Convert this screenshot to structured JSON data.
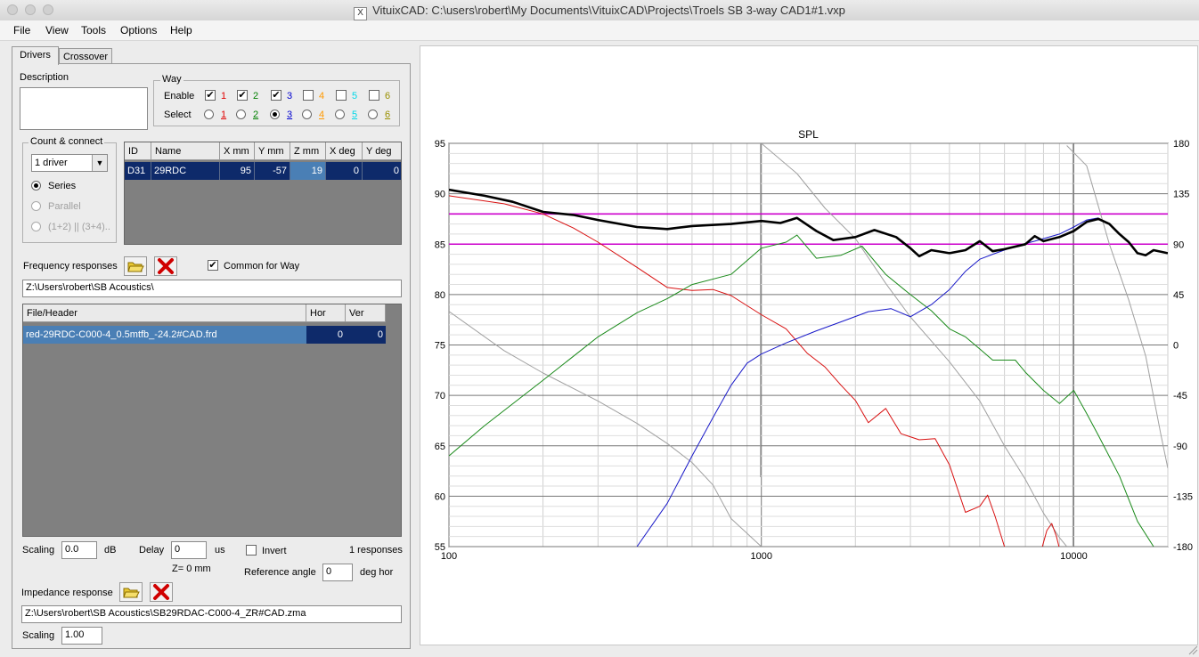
{
  "window": {
    "title": "VituixCAD: C:\\users\\robert\\My Documents\\VituixCAD\\Projects\\Troels SB 3-way CAD1#1.vxp",
    "app_icon": "app-icon"
  },
  "menu": [
    "File",
    "View",
    "Tools",
    "Options",
    "Help"
  ],
  "tabs": [
    "Drivers",
    "Crossover"
  ],
  "description": {
    "label": "Description",
    "value": ""
  },
  "way": {
    "title": "Way",
    "enable_label": "Enable",
    "select_label": "Select",
    "items": [
      {
        "n": "1",
        "color": "#e00000",
        "enabled": true,
        "selected": false
      },
      {
        "n": "2",
        "color": "#008000",
        "enabled": true,
        "selected": false
      },
      {
        "n": "3",
        "color": "#0000d0",
        "enabled": true,
        "selected": true
      },
      {
        "n": "4",
        "color": "#ff9900",
        "enabled": false,
        "selected": false
      },
      {
        "n": "5",
        "color": "#00d8e8",
        "enabled": false,
        "selected": false
      },
      {
        "n": "6",
        "color": "#9a9000",
        "enabled": false,
        "selected": false
      }
    ]
  },
  "count_connect": {
    "title": "Count & connect",
    "count": "1 driver",
    "options": [
      {
        "label": "Series",
        "selected": true,
        "disabled": false
      },
      {
        "label": "Parallel",
        "selected": false,
        "disabled": true
      },
      {
        "label": "(1+2) || (3+4)..",
        "selected": false,
        "disabled": true
      }
    ]
  },
  "driver_table": {
    "headers": [
      "ID",
      "Name",
      "X mm",
      "Y mm",
      "Z mm",
      "X deg",
      "Y deg"
    ],
    "rows": [
      [
        "D31",
        "29RDC",
        "95",
        "-57",
        "19",
        "0",
        "0"
      ]
    ]
  },
  "freq": {
    "label": "Frequency responses",
    "common_label": "Common for Way",
    "common_checked": true,
    "path": "Z:\\Users\\robert\\SB Acoustics\\"
  },
  "file_table": {
    "headers": [
      "File/Header",
      "Hor",
      "Ver"
    ],
    "rows": [
      [
        "red-29RDC-C000-4_0.5mtfb_-24.2#CAD.frd",
        "0",
        "0"
      ]
    ]
  },
  "params": {
    "scaling_label": "Scaling",
    "scaling_value": "0.0",
    "scaling_unit": "dB",
    "delay_label": "Delay",
    "delay_value": "0",
    "delay_unit": "us",
    "invert_label": "Invert",
    "responses": "1 responses",
    "z_info": "Z= 0 mm",
    "ref_angle_label": "Reference angle",
    "ref_angle_value": "0",
    "ref_angle_unit": "deg hor"
  },
  "impedance": {
    "label": "Impedance response",
    "path": "Z:\\Users\\robert\\SB Acoustics\\SB29RDAC-C000-4_ZR#CAD.zma",
    "scaling_label": "Scaling",
    "scaling_value": "1.00"
  },
  "chart_data": {
    "type": "line",
    "title": "SPL",
    "x_scale": "log",
    "xlim": [
      100,
      20000
    ],
    "ylim": [
      55,
      95
    ],
    "y2lim": [
      -180,
      180
    ],
    "x_ticks": [
      "100",
      "1000",
      "10000"
    ],
    "y_ticks": [
      "95",
      "90",
      "85",
      "80",
      "75",
      "70",
      "65",
      "60",
      "55"
    ],
    "y2_ticks": [
      "180",
      "135",
      "90",
      "45",
      "0",
      "-45",
      "-90",
      "-135",
      "-180"
    ],
    "grid": true,
    "series": [
      {
        "color": "#000000",
        "width": 2.6,
        "axis": "y",
        "points": [
          [
            100,
            90.4
          ],
          [
            130,
            89.8
          ],
          [
            160,
            89.2
          ],
          [
            200,
            88.2
          ],
          [
            250,
            87.9
          ],
          [
            300,
            87.4
          ],
          [
            400,
            86.7
          ],
          [
            500,
            86.5
          ],
          [
            600,
            86.8
          ],
          [
            800,
            87.0
          ],
          [
            1000,
            87.3
          ],
          [
            1150,
            87.1
          ],
          [
            1300,
            87.6
          ],
          [
            1500,
            86.3
          ],
          [
            1700,
            85.4
          ],
          [
            2000,
            85.7
          ],
          [
            2300,
            86.4
          ],
          [
            2700,
            85.7
          ],
          [
            3000,
            84.6
          ],
          [
            3200,
            83.8
          ],
          [
            3500,
            84.4
          ],
          [
            4000,
            84.1
          ],
          [
            4500,
            84.4
          ],
          [
            5000,
            85.3
          ],
          [
            5500,
            84.3
          ],
          [
            6000,
            84.5
          ],
          [
            7000,
            85.0
          ],
          [
            7500,
            85.8
          ],
          [
            8000,
            85.3
          ],
          [
            9000,
            85.7
          ],
          [
            10000,
            86.3
          ],
          [
            11000,
            87.2
          ],
          [
            12000,
            87.5
          ],
          [
            13000,
            87.0
          ],
          [
            14000,
            86.0
          ],
          [
            15000,
            85.2
          ],
          [
            16000,
            84.1
          ],
          [
            17000,
            83.9
          ],
          [
            18000,
            84.4
          ],
          [
            20000,
            84.1
          ]
        ]
      },
      {
        "color": "#d81010",
        "width": 1,
        "axis": "y",
        "points": [
          [
            100,
            89.8
          ],
          [
            150,
            89.0
          ],
          [
            200,
            88.0
          ],
          [
            250,
            86.6
          ],
          [
            300,
            85.2
          ],
          [
            400,
            82.7
          ],
          [
            500,
            80.7
          ],
          [
            600,
            80.4
          ],
          [
            700,
            80.5
          ],
          [
            800,
            79.9
          ],
          [
            1000,
            78.0
          ],
          [
            1200,
            76.6
          ],
          [
            1400,
            74.2
          ],
          [
            1600,
            72.8
          ],
          [
            1800,
            71.0
          ],
          [
            2000,
            69.5
          ],
          [
            2200,
            67.3
          ],
          [
            2500,
            68.7
          ],
          [
            2800,
            66.2
          ],
          [
            3200,
            65.6
          ],
          [
            3600,
            65.7
          ],
          [
            4000,
            63.1
          ],
          [
            4500,
            58.4
          ],
          [
            5000,
            59.0
          ],
          [
            5300,
            60.1
          ],
          [
            5600,
            58.0
          ],
          [
            6000,
            55.0
          ]
        ]
      },
      {
        "color": "#d81010",
        "width": 1,
        "axis": "y",
        "points": [
          [
            7900,
            54.8
          ],
          [
            8200,
            56.6
          ],
          [
            8500,
            57.3
          ],
          [
            8800,
            56.0
          ],
          [
            9000,
            54.8
          ]
        ]
      },
      {
        "color": "#1a8a1a",
        "width": 1,
        "axis": "y",
        "points": [
          [
            100,
            64.0
          ],
          [
            130,
            67.0
          ],
          [
            200,
            71.5
          ],
          [
            300,
            75.8
          ],
          [
            400,
            78.2
          ],
          [
            500,
            79.6
          ],
          [
            600,
            81.0
          ],
          [
            800,
            82.0
          ],
          [
            1000,
            84.6
          ],
          [
            1200,
            85.2
          ],
          [
            1300,
            85.9
          ],
          [
            1500,
            83.6
          ],
          [
            1800,
            83.9
          ],
          [
            2100,
            84.8
          ],
          [
            2500,
            82.0
          ],
          [
            3000,
            80.0
          ],
          [
            3500,
            78.4
          ],
          [
            4000,
            76.6
          ],
          [
            4500,
            75.8
          ],
          [
            5000,
            74.6
          ],
          [
            5500,
            73.5
          ],
          [
            6500,
            73.5
          ],
          [
            7000,
            72.3
          ],
          [
            8000,
            70.5
          ],
          [
            9000,
            69.2
          ],
          [
            10000,
            70.5
          ],
          [
            11000,
            68.2
          ],
          [
            12000,
            66.0
          ],
          [
            14000,
            62.0
          ],
          [
            16000,
            57.5
          ],
          [
            18000,
            55.0
          ]
        ]
      },
      {
        "color": "#1818c8",
        "width": 1,
        "axis": "y",
        "points": [
          [
            400,
            55.0
          ],
          [
            500,
            59.3
          ],
          [
            600,
            64.0
          ],
          [
            700,
            67.8
          ],
          [
            800,
            71.0
          ],
          [
            900,
            73.2
          ],
          [
            1000,
            74.1
          ],
          [
            1200,
            75.2
          ],
          [
            1500,
            76.4
          ],
          [
            1800,
            77.3
          ],
          [
            2200,
            78.3
          ],
          [
            2600,
            78.6
          ],
          [
            3000,
            77.8
          ],
          [
            3500,
            79.0
          ],
          [
            4000,
            80.5
          ],
          [
            4500,
            82.3
          ],
          [
            5000,
            83.5
          ],
          [
            5500,
            84.0
          ],
          [
            6500,
            84.8
          ],
          [
            7500,
            85.3
          ],
          [
            9000,
            86.0
          ],
          [
            10000,
            86.7
          ],
          [
            11000,
            87.4
          ],
          [
            12000,
            87.6
          ]
        ]
      },
      {
        "color": "#a0a0a0",
        "width": 1,
        "axis": "y2",
        "points": [
          [
            100,
            30
          ],
          [
            150,
            -5
          ],
          [
            200,
            -25
          ],
          [
            300,
            -50
          ],
          [
            400,
            -70
          ],
          [
            500,
            -88
          ],
          [
            600,
            -105
          ],
          [
            700,
            -125
          ],
          [
            800,
            -155
          ],
          [
            1000,
            -180
          ]
        ]
      },
      {
        "color": "#a0a0a0",
        "width": 1,
        "axis": "y2",
        "points": [
          [
            1000,
            180
          ],
          [
            1300,
            153
          ],
          [
            1600,
            122
          ],
          [
            2000,
            95
          ],
          [
            2500,
            55
          ],
          [
            3000,
            25
          ],
          [
            4000,
            -15
          ],
          [
            5000,
            -50
          ],
          [
            6000,
            -90
          ],
          [
            7000,
            -120
          ],
          [
            8000,
            -150
          ],
          [
            9000,
            -172
          ],
          [
            9500,
            -180
          ]
        ]
      },
      {
        "color": "#a0a0a0",
        "width": 1,
        "axis": "y2",
        "points": [
          [
            9500,
            178
          ],
          [
            11000,
            160
          ],
          [
            13000,
            90
          ],
          [
            15000,
            40
          ],
          [
            17000,
            -10
          ],
          [
            19000,
            -80
          ],
          [
            20000,
            -110
          ]
        ]
      }
    ],
    "reference_lines": [
      {
        "color": "#cc00cc",
        "y": 88
      },
      {
        "color": "#cc00cc",
        "y": 85
      }
    ],
    "markers": [
      {
        "color": "#999999",
        "x": 1000
      },
      {
        "color": "#999999",
        "x": 10000
      }
    ]
  }
}
